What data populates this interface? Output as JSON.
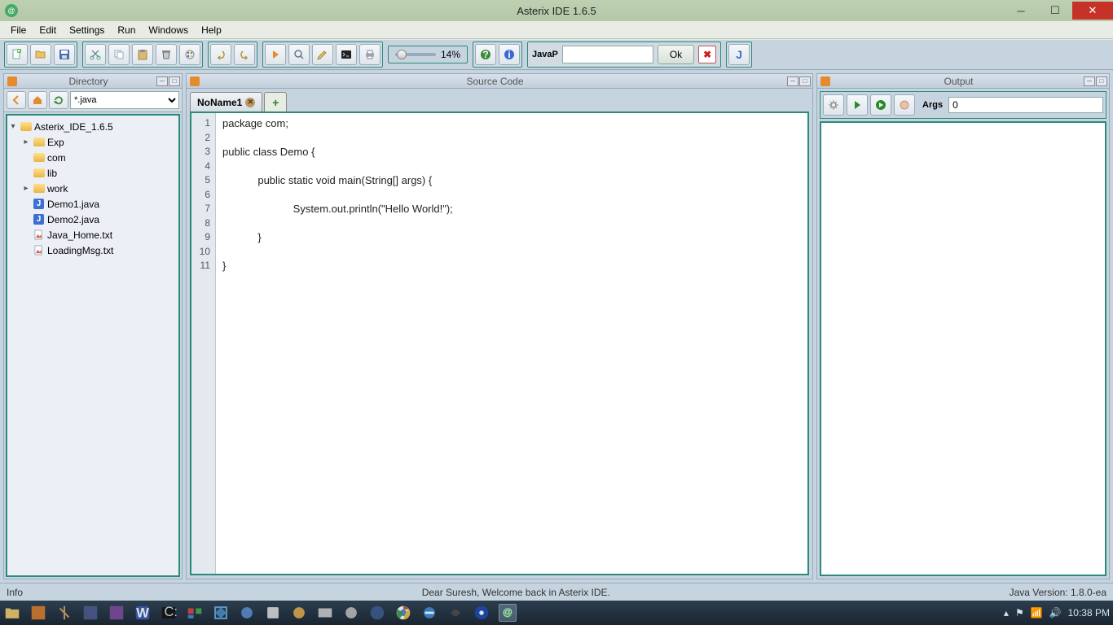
{
  "window": {
    "title": "Asterix IDE 1.6.5"
  },
  "menus": [
    "File",
    "Edit",
    "Settings",
    "Run",
    "Windows",
    "Help"
  ],
  "slider_pct": "14%",
  "javap": {
    "label": "JavaP",
    "ok": "Ok",
    "value": ""
  },
  "panels": {
    "dir": "Directory",
    "src": "Source Code",
    "out": "Output"
  },
  "dir_filter": "*.java",
  "tree": {
    "root": "Asterix_IDE_1.6.5",
    "folders": [
      "Exp",
      "com",
      "lib",
      "work"
    ],
    "jfiles": [
      "Demo1.java",
      "Demo2.java"
    ],
    "tfiles": [
      "Java_Home.txt",
      "LoadingMsg.txt"
    ]
  },
  "tab_name": "NoName1",
  "code_lines": [
    "package com;",
    "",
    "public class Demo {",
    "",
    "            public static void main(String[] args) {",
    "",
    "                        System.out.println(\"Hello World!\");",
    "",
    "            }",
    "",
    "}"
  ],
  "out_args": {
    "label": "Args",
    "value": "0"
  },
  "status": {
    "info": "Info",
    "msg": "Dear Suresh, Welcome back in Asterix IDE.",
    "java": "Java Version: 1.8.0-ea"
  },
  "clock": "10:38 PM"
}
